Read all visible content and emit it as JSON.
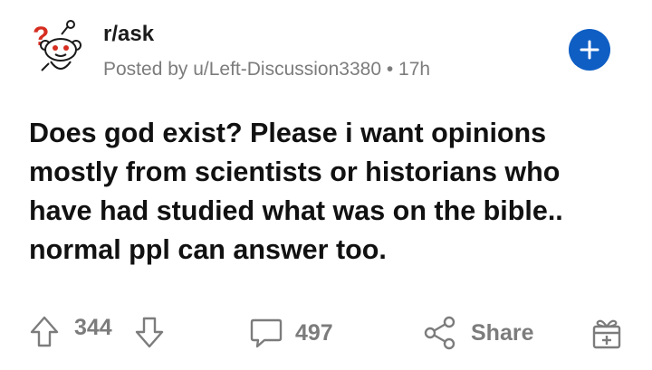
{
  "post": {
    "subreddit": "r/ask",
    "meta": "Posted by u/Left-Discussion3380 • 17h",
    "title": "Does god exist? Please i want opinions mostly from scientists or historians who have had studied what was on the bible.. normal ppl can answer too."
  },
  "actions": {
    "votes": "344",
    "comments": "497",
    "share_label": "Share"
  },
  "icons": {
    "avatar": "reddit-snoo-question-icon",
    "join": "plus-icon",
    "upvote": "arrow-up-icon",
    "downvote": "arrow-down-icon",
    "comment": "comment-bubble-icon",
    "share": "share-icon",
    "award": "gift-icon"
  },
  "colors": {
    "accent": "#0e5ec4",
    "muted": "#7c7c7c",
    "text": "#1a1a1b",
    "question_mark": "#d62d20"
  }
}
